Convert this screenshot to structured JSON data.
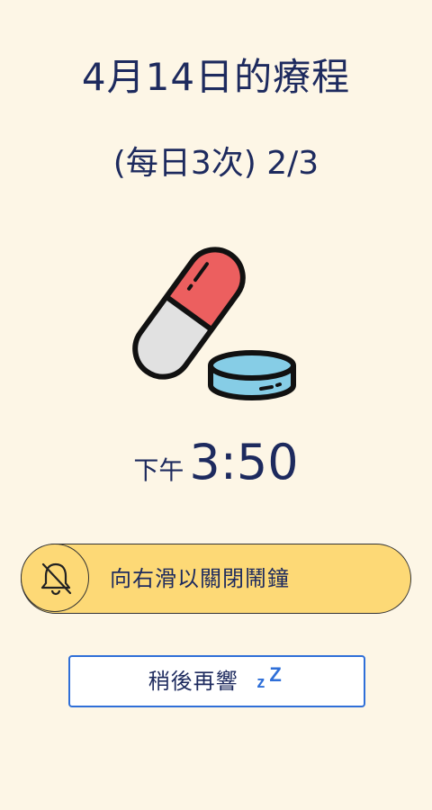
{
  "header": {
    "title": "4月14日的療程",
    "subtitle": "(每日3次) 2/3"
  },
  "art": {
    "icon": "pill-capsule-and-tablet-icon"
  },
  "time": {
    "ampm": "下午",
    "clock": "3:50"
  },
  "slider": {
    "label": "向右滑以關閉鬧鐘",
    "icon": "bell-off-icon",
    "color": "#fdd976"
  },
  "snooze": {
    "label": "稍後再響",
    "z_small": "z",
    "z_large": "Z",
    "accent": "#2f6fd8"
  },
  "colors": {
    "background": "#fdf6e6",
    "text": "#1d2a5e",
    "capsule_red": "#ec5f5f",
    "capsule_gray": "#e1e1e1",
    "tablet_blue": "#86cde6"
  }
}
